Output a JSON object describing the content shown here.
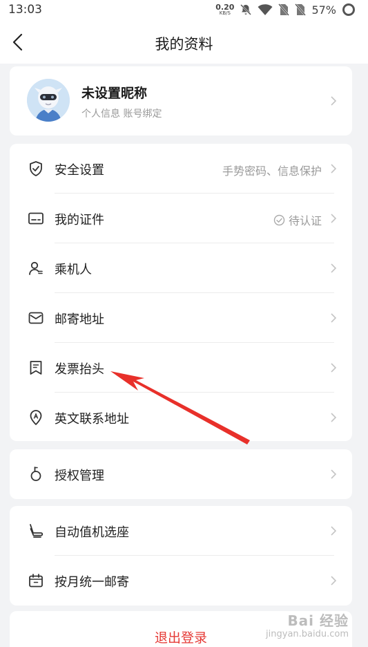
{
  "status": {
    "time": "13:03",
    "net_value": "0.20",
    "net_unit": "KB/S",
    "battery": "57%"
  },
  "nav": {
    "title": "我的资料"
  },
  "profile": {
    "nickname": "未设置昵称",
    "subtitle": "个人信息 账号绑定"
  },
  "groups": [
    {
      "items": [
        {
          "label": "安全设置",
          "value": "手势密码、信息保护",
          "icon": "shield-icon"
        },
        {
          "label": "我的证件",
          "value": "待认证",
          "icon": "id-card-icon"
        },
        {
          "label": "乘机人",
          "icon": "passenger-icon"
        },
        {
          "label": "邮寄地址",
          "icon": "envelope-icon"
        },
        {
          "label": "发票抬头",
          "icon": "bookmark-icon"
        },
        {
          "label": "英文联系地址",
          "icon": "location-a-icon"
        }
      ]
    },
    {
      "items": [
        {
          "label": "授权管理",
          "icon": "authorize-icon"
        }
      ]
    },
    {
      "items": [
        {
          "label": "自动值机选座",
          "icon": "seat-icon"
        },
        {
          "label": "按月统一邮寄",
          "icon": "calendar-box-icon"
        }
      ]
    }
  ],
  "logout": "退出登录",
  "watermark": {
    "brand": "Bai 经验",
    "url": "jingyan.baidu.com"
  },
  "colors": {
    "background": "#f2f3f5",
    "card": "#ffffff",
    "logout": "#e53935",
    "annotation_arrow": "#e8302a"
  }
}
